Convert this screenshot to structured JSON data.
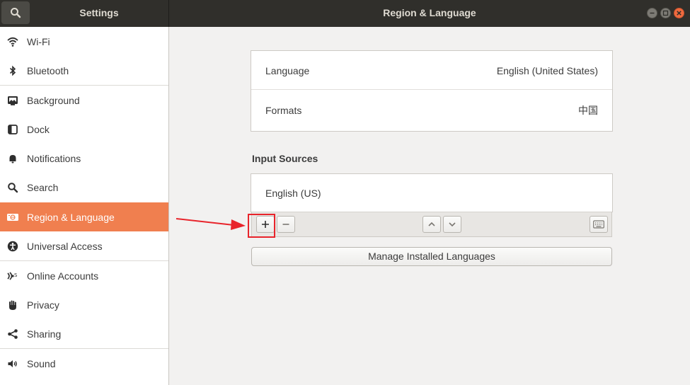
{
  "window": {
    "sidebar_title": "Settings",
    "panel_title": "Region & Language"
  },
  "sidebar": {
    "items": [
      {
        "label": "Wi-Fi",
        "icon": "wifi-icon"
      },
      {
        "label": "Bluetooth",
        "icon": "bluetooth-icon"
      },
      {
        "label": "Background",
        "icon": "background-icon"
      },
      {
        "label": "Dock",
        "icon": "dock-icon"
      },
      {
        "label": "Notifications",
        "icon": "bell-icon"
      },
      {
        "label": "Search",
        "icon": "search-icon"
      },
      {
        "label": "Region & Language",
        "icon": "region-icon",
        "active": true
      },
      {
        "label": "Universal Access",
        "icon": "accessibility-icon"
      },
      {
        "label": "Online Accounts",
        "icon": "online-accounts-icon"
      },
      {
        "label": "Privacy",
        "icon": "hand-icon"
      },
      {
        "label": "Sharing",
        "icon": "share-icon"
      },
      {
        "label": "Sound",
        "icon": "speaker-icon"
      }
    ]
  },
  "main": {
    "language_label": "Language",
    "language_value": "English (United States)",
    "formats_label": "Formats",
    "formats_value": "中国",
    "input_sources_title": "Input Sources",
    "input_sources": [
      {
        "label": "English (US)"
      }
    ],
    "manage_button": "Manage Installed Languages"
  },
  "colors": {
    "accent": "#f07f4f",
    "titlebar": "#302f2b",
    "annotation": "#e8242b"
  }
}
